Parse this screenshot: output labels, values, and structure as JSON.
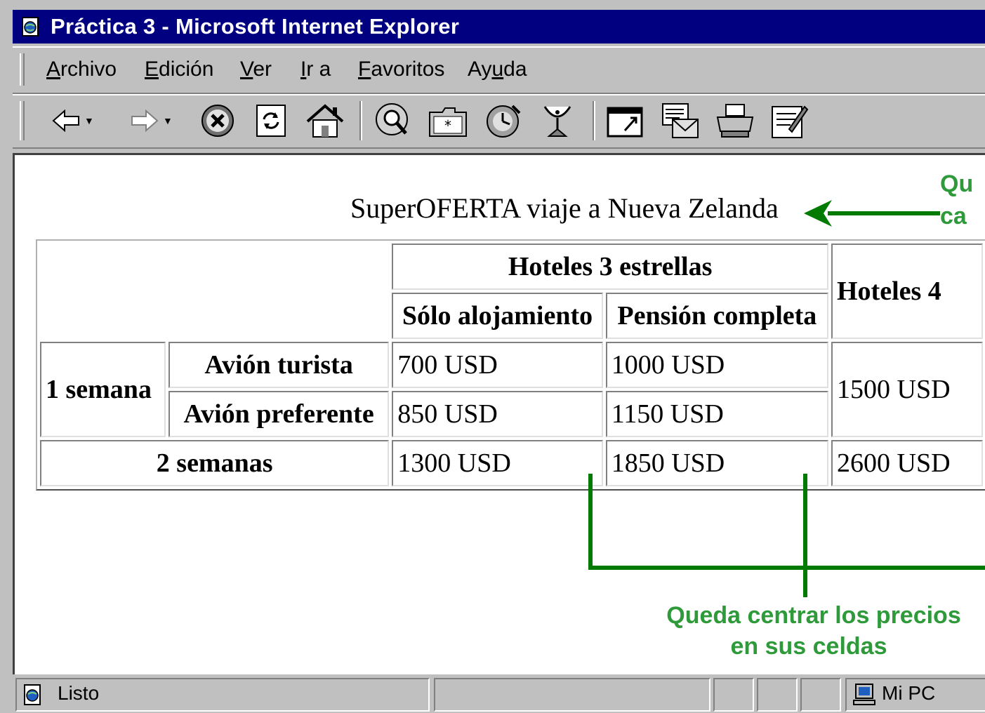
{
  "window": {
    "title": "Práctica 3 - Microsoft Internet Explorer"
  },
  "menu": {
    "items": [
      {
        "label": "Archivo",
        "underline": "A"
      },
      {
        "label": "Edición",
        "underline": "E"
      },
      {
        "label": "Ver",
        "underline": "V"
      },
      {
        "label": "Ir a",
        "underline": "I"
      },
      {
        "label": "Favoritos",
        "underline": "F"
      },
      {
        "label": "Ayuda",
        "underline": "u"
      }
    ]
  },
  "toolbar": {
    "buttons": [
      "back-icon",
      "forward-icon",
      "stop-icon",
      "refresh-icon",
      "home-icon",
      "search-icon",
      "favorites-icon",
      "history-icon",
      "channels-icon",
      "fullscreen-icon",
      "mail-icon",
      "print-icon",
      "edit-icon"
    ]
  },
  "page": {
    "heading": "SuperOFERTA viaje a Nueva Zelanda",
    "table": {
      "header_3_stars": "Hoteles 3 estrellas",
      "header_4_stars": "Hoteles 4",
      "sub_only_lodging": "Sólo alojamiento",
      "sub_full_board": "Pensión completa",
      "row_1_week": "1 semana",
      "row_tourist": "Avión turista",
      "row_preferred": "Avión preferente",
      "row_2_weeks": "2 semanas",
      "p_tourist_lodging": "700 USD",
      "p_tourist_full": "1000 USD",
      "p_week_4star": "1500 USD",
      "p_pref_lodging": "850 USD",
      "p_pref_full": "1150 USD",
      "p_2w_lodging": "1300 USD",
      "p_2w_full": "1850 USD",
      "p_2w_4star": "2600 USD"
    },
    "note_top_line1": "Qu",
    "note_top_line2": "ca",
    "note_bottom_line1": "Queda centrar los precios",
    "note_bottom_line2": "en sus celdas",
    "annotation_color": "#2e9a3a",
    "arrow_color": "#007a00"
  },
  "statusbar": {
    "status": "Listo",
    "zone": "Mi PC"
  }
}
